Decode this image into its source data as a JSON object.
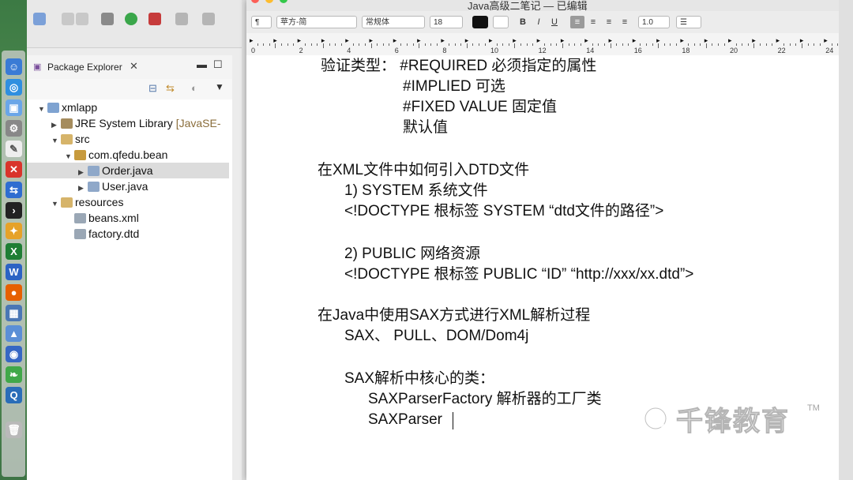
{
  "eclipse": {
    "panel_title": "Package Explorer",
    "tree": [
      {
        "label": "xmlapp",
        "indent": 0,
        "expanded": true,
        "icon": "project-icon"
      },
      {
        "label": "JRE System Library",
        "suffix": "[JavaSE-",
        "indent": 1,
        "expanded": false,
        "icon": "library-icon"
      },
      {
        "label": "src",
        "indent": 1,
        "expanded": true,
        "icon": "source-folder-icon"
      },
      {
        "label": "com.qfedu.bean",
        "indent": 2,
        "expanded": true,
        "icon": "package-icon"
      },
      {
        "label": "Order.java",
        "indent": 3,
        "expanded": false,
        "icon": "java-file-icon",
        "selected": true
      },
      {
        "label": "User.java",
        "indent": 3,
        "expanded": false,
        "icon": "java-file-icon"
      },
      {
        "label": "resources",
        "indent": 1,
        "expanded": true,
        "icon": "folder-icon"
      },
      {
        "label": "beans.xml",
        "indent": 2,
        "icon": "xml-file-icon"
      },
      {
        "label": "factory.dtd",
        "indent": 2,
        "icon": "dtd-file-icon"
      }
    ]
  },
  "textedit": {
    "title": "Java高级二笔记 — 已编辑",
    "format_bar": {
      "paragraph": "¶",
      "font_family": "苹方-简",
      "font_style": "常规体",
      "font_size": "18",
      "bold": "B",
      "italic": "I",
      "underline": "U",
      "line_spacing": "1.0"
    },
    "ruler_numbers": [
      "0",
      "2",
      "4",
      "6",
      "8",
      "10",
      "12",
      "14",
      "16",
      "18",
      "20",
      "22",
      "24"
    ],
    "lines": [
      "验证类型：  #REQUIRED  必须指定的属性",
      "#IMPLIED 可选",
      "#FIXED VALUE  固定值",
      "默认值",
      "在XML文件中如何引入DTD文件",
      "1) SYSTEM 系统文件",
      "<!DOCTYPE 根标签 SYSTEM “dtd文件的路径”>",
      "2) PUBLIC 网络资源",
      "<!DOCTYPE 根标签 PUBLIC “ID” “http://xxx/xx.dtd”>",
      "在Java中使用SAX方式进行XML解析过程",
      "SAX、 PULL、DOM/Dom4j",
      "SAX解析中核心的类：",
      "SAXParserFactory  解析器的工厂类",
      "SAXParser"
    ]
  },
  "watermark": {
    "text": "千锋教育",
    "tm": "TM"
  }
}
